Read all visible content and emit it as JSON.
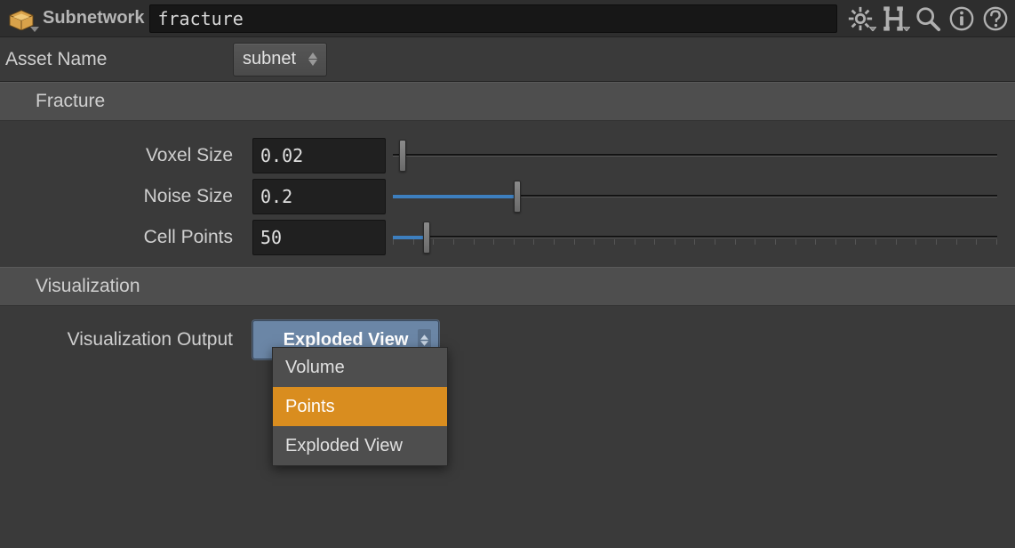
{
  "header": {
    "node_type_label": "Subnetwork",
    "node_name": "fracture"
  },
  "asset": {
    "label": "Asset Name",
    "value": "subnet"
  },
  "groups": {
    "fracture": {
      "title": "Fracture",
      "params": {
        "voxel": {
          "label": "Voxel Size",
          "value": "0.02",
          "fill_pct": 0,
          "handle_pct": 1,
          "ticks": false
        },
        "noise": {
          "label": "Noise Size",
          "value": "0.2",
          "fill_pct": 20,
          "handle_pct": 20,
          "ticks": false
        },
        "cells": {
          "label": "Cell Points",
          "value": "50",
          "fill_pct": 5,
          "handle_pct": 5,
          "ticks": true
        }
      }
    },
    "viz": {
      "title": "Visualization",
      "output_label": "Visualization Output",
      "selected": "Exploded View",
      "options": [
        "Volume",
        "Points",
        "Exploded View"
      ],
      "hover_index": 1
    }
  }
}
